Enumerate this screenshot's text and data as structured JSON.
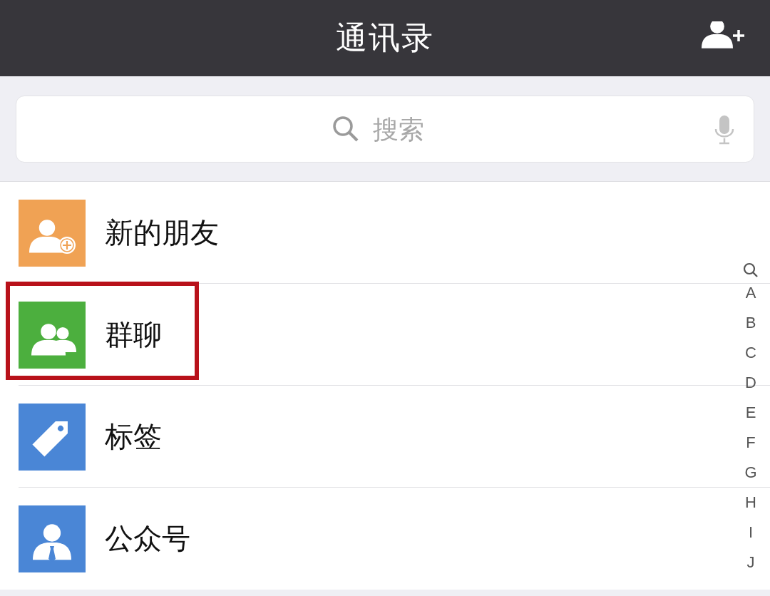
{
  "header": {
    "title": "通讯录"
  },
  "search": {
    "placeholder": "搜索"
  },
  "entries": [
    {
      "label": "新的朋友",
      "kind": "new-friends",
      "color": "#f0a254",
      "highlighted": false
    },
    {
      "label": "群聊",
      "kind": "group",
      "color": "#4caf3e",
      "highlighted": true
    },
    {
      "label": "标签",
      "kind": "tag",
      "color": "#4a86d6",
      "highlighted": false
    },
    {
      "label": "公众号",
      "kind": "official",
      "color": "#4a86d6",
      "highlighted": false
    }
  ],
  "index": [
    "A",
    "B",
    "C",
    "D",
    "E",
    "F",
    "G",
    "H",
    "I",
    "J"
  ]
}
